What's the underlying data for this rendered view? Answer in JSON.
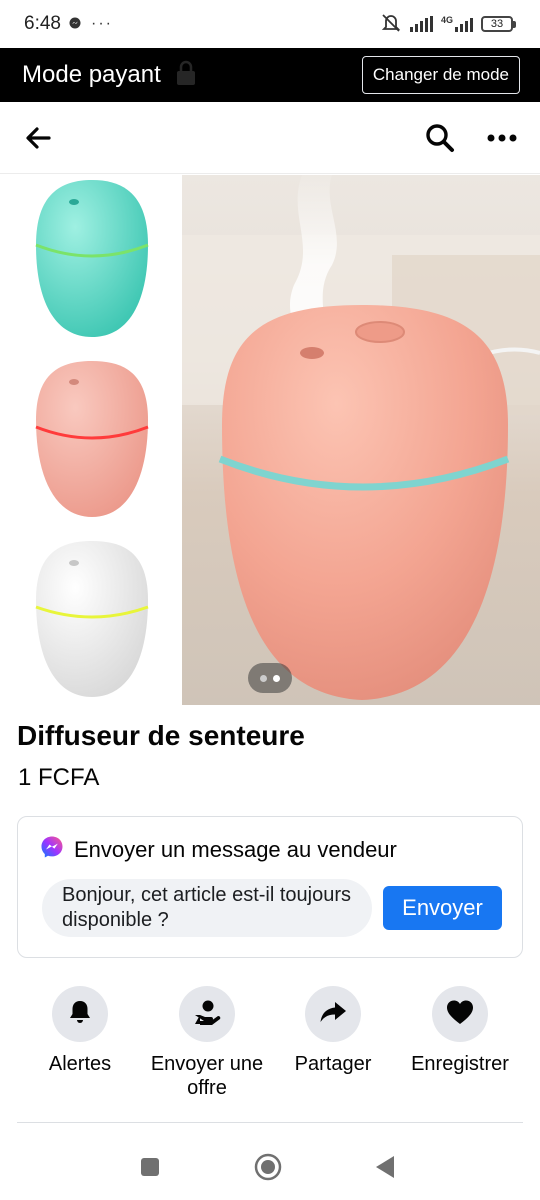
{
  "status_bar": {
    "time": "6:48",
    "network": "4G",
    "battery": "33"
  },
  "mode_banner": {
    "label": "Mode payant",
    "button": "Changer de mode"
  },
  "product": {
    "title": "Diffuseur de senteure",
    "price": "1 FCFA",
    "photo_count": 2,
    "photo_index": 2
  },
  "message": {
    "title": "Envoyer un message au vendeur",
    "input_value": "Bonjour, cet article est-il toujours disponible ?",
    "send_label": "Envoyer"
  },
  "actions": [
    {
      "label": "Alertes",
      "icon": "bell-icon"
    },
    {
      "label": "Envoyer une offre",
      "icon": "offer-icon"
    },
    {
      "label": "Partager",
      "icon": "share-icon"
    },
    {
      "label": "Enregistrer",
      "icon": "heart-icon"
    }
  ],
  "colors": {
    "accent": "#1877f2",
    "banner_bg": "#000000",
    "action_circle": "#e4e6eb"
  }
}
